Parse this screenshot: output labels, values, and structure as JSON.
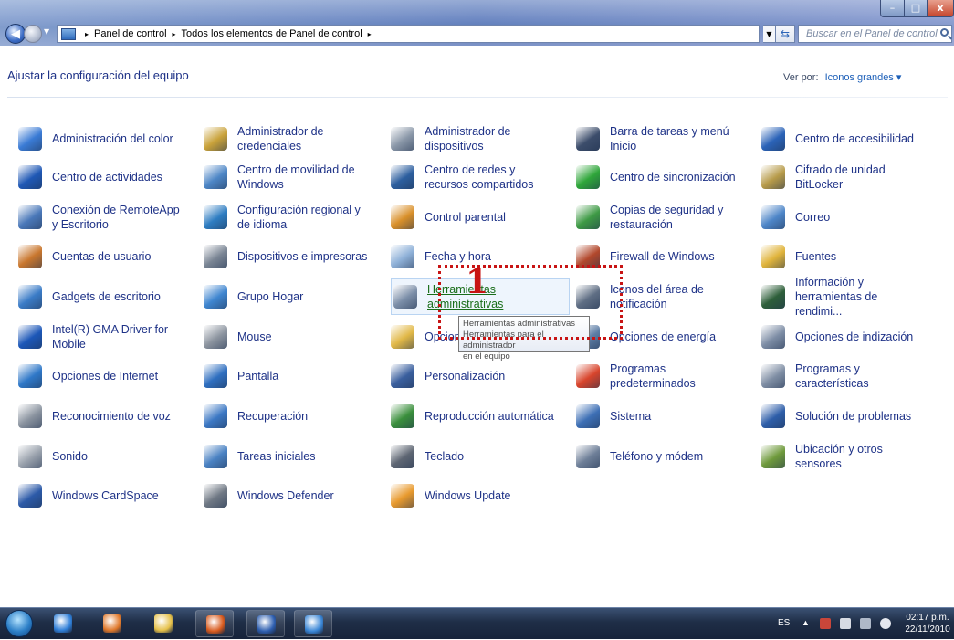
{
  "window": {
    "min_glyph": "–",
    "max_glyph": "□",
    "close_glyph": "x"
  },
  "address": {
    "crumbs": [
      "Panel de control",
      "Todos los elementos de Panel de control"
    ],
    "separator": "▸",
    "search_placeholder": "Buscar en el Panel de control"
  },
  "header": {
    "title": "Ajustar la configuración del equipo",
    "view_by_label": "Ver por:",
    "view_by_value": "Iconos grandes ▾"
  },
  "items": [
    {
      "label": "Administración del color",
      "icon": "color-management-icon",
      "color": "#3a7bd5"
    },
    {
      "label": "Administrador de credenciales",
      "icon": "credential-manager-icon",
      "color": "#c9a23a"
    },
    {
      "label": "Administrador de dispositivos",
      "icon": "device-manager-icon",
      "color": "#8a97a8"
    },
    {
      "label": "Barra de tareas y menú Inicio",
      "icon": "taskbar-icon",
      "color": "#3c4d6b"
    },
    {
      "label": "Centro de accesibilidad",
      "icon": "accessibility-icon",
      "color": "#2b63b8"
    },
    {
      "label": "Centro de actividades",
      "icon": "action-center-flag-icon",
      "color": "#1f58b5"
    },
    {
      "label": "Centro de movilidad de Windows",
      "icon": "mobility-center-icon",
      "color": "#4d86c6"
    },
    {
      "label": "Centro de redes y recursos compartidos",
      "icon": "network-center-icon",
      "color": "#2d5f9f"
    },
    {
      "label": "Centro de sincronización",
      "icon": "sync-center-icon",
      "color": "#2fa63a"
    },
    {
      "label": "Cifrado de unidad BitLocker",
      "icon": "bitlocker-key-icon",
      "color": "#b79b4a"
    },
    {
      "label": "Conexión de RemoteApp y Escritorio",
      "icon": "remoteapp-icon",
      "color": "#4a78b9"
    },
    {
      "label": "Configuración regional y de idioma",
      "icon": "globe-icon",
      "color": "#2e7dc2"
    },
    {
      "label": "Control parental",
      "icon": "parental-control-icon",
      "color": "#d9902a"
    },
    {
      "label": "Copias de seguridad y restauración",
      "icon": "backup-icon",
      "color": "#3e9a45"
    },
    {
      "label": "Correo",
      "icon": "mail-icon",
      "color": "#4e86c8"
    },
    {
      "label": "Cuentas de usuario",
      "icon": "user-accounts-icon",
      "color": "#c9772e"
    },
    {
      "label": "Dispositivos e impresoras",
      "icon": "printer-icon",
      "color": "#7a8594"
    },
    {
      "label": "Fecha y hora",
      "icon": "clock-calendar-icon",
      "color": "#8fb1d8"
    },
    {
      "label": "Firewall de Windows",
      "icon": "firewall-icon",
      "color": "#b2482c"
    },
    {
      "label": "Fuentes",
      "icon": "fonts-folder-icon",
      "color": "#e0b43c"
    },
    {
      "label": "Gadgets de escritorio",
      "icon": "gadgets-icon",
      "color": "#3b7cc7"
    },
    {
      "label": "Grupo Hogar",
      "icon": "homegroup-icon",
      "color": "#3f86d0"
    },
    {
      "label": "Herramientas administrativas",
      "icon": "admin-tools-icon",
      "color": "#7b8ea8"
    },
    {
      "label": "Iconos del área de notificación",
      "icon": "notification-area-icon",
      "color": "#5f6e84"
    },
    {
      "label": "Información y herramientas de rendimi...",
      "icon": "performance-icon",
      "color": "#2e5f3a"
    },
    {
      "label": "Intel(R) GMA Driver for Mobile",
      "icon": "intel-driver-icon",
      "color": "#1c57b8"
    },
    {
      "label": "Mouse",
      "icon": "mouse-icon",
      "color": "#8c949f"
    },
    {
      "label": "Opciones de carpeta",
      "icon": "folder-options-icon",
      "color": "#e1b847"
    },
    {
      "label": "Opciones de energía",
      "icon": "power-options-icon",
      "color": "#5d7ea6"
    },
    {
      "label": "Opciones de indización",
      "icon": "indexing-icon",
      "color": "#7d8da5"
    },
    {
      "label": "Opciones de Internet",
      "icon": "internet-options-icon",
      "color": "#2f78c8"
    },
    {
      "label": "Pantalla",
      "icon": "display-icon",
      "color": "#2f6fc0"
    },
    {
      "label": "Personalización",
      "icon": "personalization-icon",
      "color": "#3a5f9e"
    },
    {
      "label": "Programas predeterminados",
      "icon": "default-programs-icon",
      "color": "#d8452c"
    },
    {
      "label": "Programas y características",
      "icon": "programs-features-icon",
      "color": "#7f8ea4"
    },
    {
      "label": "Reconocimiento de voz",
      "icon": "microphone-icon",
      "color": "#8a939f"
    },
    {
      "label": "Recuperación",
      "icon": "recovery-icon",
      "color": "#3c78c4"
    },
    {
      "label": "Reproducción automática",
      "icon": "autoplay-icon",
      "color": "#3a8f3c"
    },
    {
      "label": "Sistema",
      "icon": "system-icon",
      "color": "#3d6fb5"
    },
    {
      "label": "Solución de problemas",
      "icon": "troubleshooting-icon",
      "color": "#2e5ea9"
    },
    {
      "label": "Sonido",
      "icon": "speaker-icon",
      "color": "#9aa2ad"
    },
    {
      "label": "Tareas iniciales",
      "icon": "getting-started-icon",
      "color": "#4a82c3"
    },
    {
      "label": "Teclado",
      "icon": "keyboard-icon",
      "color": "#5e6673"
    },
    {
      "label": "Teléfono y módem",
      "icon": "phone-modem-icon",
      "color": "#6e7f98"
    },
    {
      "label": "Ubicación y otros sensores",
      "icon": "location-sensors-icon",
      "color": "#6f9a3c"
    },
    {
      "label": "Windows CardSpace",
      "icon": "cardspace-icon",
      "color": "#2c5aa8"
    },
    {
      "label": "Windows Defender",
      "icon": "windows-defender-icon",
      "color": "#6f7884"
    },
    {
      "label": "Windows Update",
      "icon": "windows-update-icon",
      "color": "#e89a2e"
    }
  ],
  "hovered_item": "Herramientas administrativas",
  "tooltip": {
    "text": "Herramientas administrativas",
    "text2": "Herramientas para el administrador",
    "text3": "en el equipo"
  },
  "annotation": {
    "number": "1",
    "color": "#c81414"
  },
  "taskbar": {
    "apps": [
      {
        "name": "internet-explorer-icon",
        "color": "#2f7fd8",
        "pinned": false
      },
      {
        "name": "media-player-icon",
        "color": "#e0782a",
        "pinned": false
      },
      {
        "name": "explorer-folder-icon",
        "color": "#e6c14a",
        "pinned": false
      },
      {
        "name": "firefox-icon",
        "color": "#d85b1e",
        "pinned": true
      },
      {
        "name": "word-icon",
        "color": "#2e5fb0",
        "pinned": true
      },
      {
        "name": "control-panel-icon",
        "color": "#3a86d6",
        "pinned": true
      }
    ],
    "tray": {
      "language": "ES",
      "arrow": "▲",
      "time": "02:17 p.m.",
      "date": "22/11/2010"
    }
  }
}
